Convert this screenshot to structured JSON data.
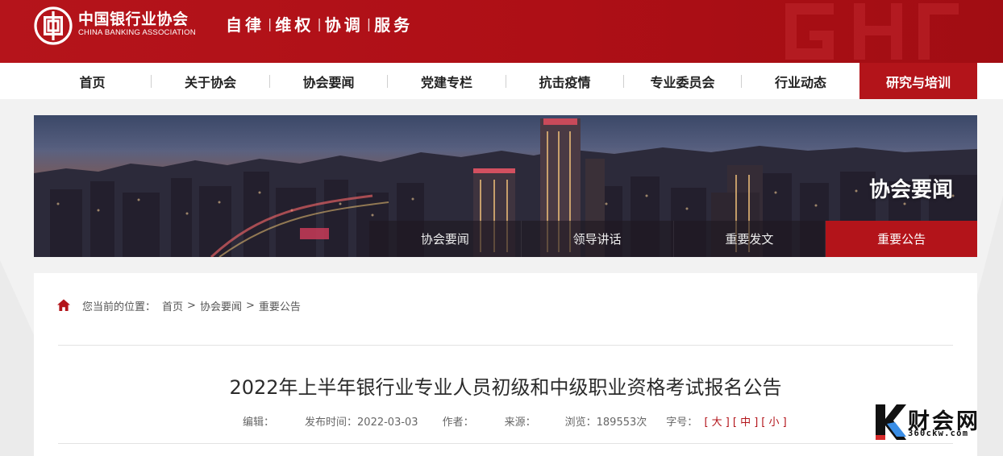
{
  "header": {
    "logo_cn": "中国银行业协会",
    "logo_en": "CHINA BANKING ASSOCIATION",
    "slogan": [
      "自律",
      "维权",
      "协调",
      "服务"
    ],
    "slogan_separator": "|"
  },
  "nav": {
    "items": [
      {
        "label": "首页"
      },
      {
        "label": "关于协会"
      },
      {
        "label": "协会要闻"
      },
      {
        "label": "党建专栏"
      },
      {
        "label": "抗击疫情"
      },
      {
        "label": "专业委员会"
      },
      {
        "label": "行业动态"
      },
      {
        "label": "研究与培训",
        "active": true
      }
    ]
  },
  "banner": {
    "title": "协会要闻",
    "subnav": [
      {
        "label": "协会要闻"
      },
      {
        "label": "领导讲话"
      },
      {
        "label": "重要发文"
      },
      {
        "label": "重要公告",
        "active": true
      }
    ]
  },
  "breadcrumb": {
    "prefix": "您当前的位置：",
    "items": [
      "首页",
      "协会要闻",
      "重要公告"
    ],
    "separator": ">"
  },
  "article": {
    "title": "2022年上半年银行业专业人员初级和中级职业资格考试报名公告",
    "editor_label": "编辑：",
    "editor": "",
    "publish_label": "发布时间：",
    "publish_date": "2022-03-03",
    "author_label": "作者：",
    "author": "",
    "source_label": "来源：",
    "source": "",
    "views_label": "浏览：",
    "views": "189553次",
    "fontsize_label": "字号：",
    "fontsize_options": [
      "[ 大 ]",
      "[ 中 ]",
      "[ 小 ]"
    ]
  },
  "watermark": {
    "brand": "财会网",
    "url": "360ckw.com"
  },
  "colors": {
    "brand_red": "#b3141a",
    "header_red": "#ae0f16",
    "text_dark": "#2b2b2b"
  },
  "icons": {
    "home": "home-icon",
    "logo": "association-logo-icon"
  }
}
